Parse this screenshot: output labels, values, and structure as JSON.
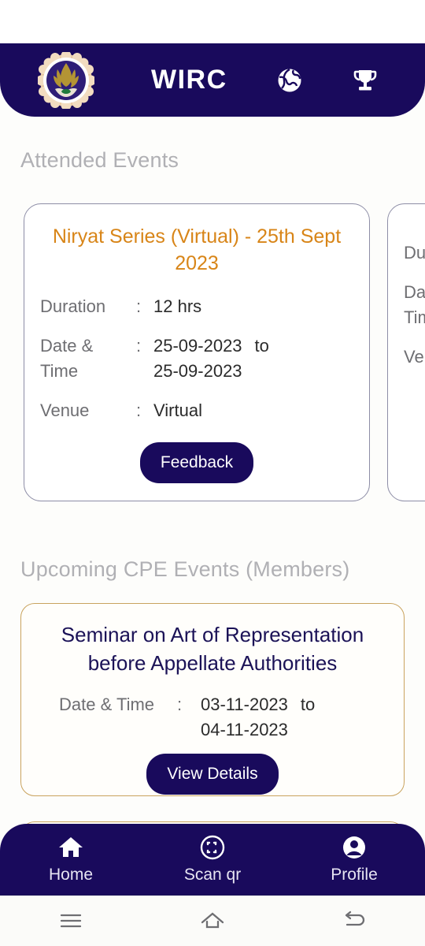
{
  "header": {
    "brand": "WIRC",
    "logo_icon": "icai-emblem-icon",
    "globe_icon": "globe-icon",
    "trophy_icon": "trophy-icon"
  },
  "sections": {
    "attended_title": "Attended Events",
    "upcoming_title": "Upcoming CPE Events (Members)"
  },
  "attended_events": [
    {
      "title": "Niryat Series (Virtual) - 25th Sept 2023",
      "duration_label": "Duration",
      "duration_value": "12 hrs",
      "datetime_label_line1": "Date &",
      "datetime_label_line2": "Time",
      "date_from": "25-09-2023",
      "date_to_word": "to",
      "date_to": "25-09-2023",
      "venue_label": "Venue",
      "venue_value": "Virtual",
      "colon": ":",
      "button_label": "Feedback"
    },
    {
      "title": "",
      "duration_label": "Duration",
      "duration_value": "",
      "datetime_label_line1": "Date &",
      "datetime_label_line2": "Time",
      "date_from": "",
      "date_to_word": "",
      "date_to": "",
      "venue_label": "Venue",
      "venue_value": "",
      "colon": ":",
      "button_label": ""
    }
  ],
  "upcoming_event": {
    "title": "Seminar on Art of Representation before Appellate Authorities",
    "datetime_label": "Date & Time",
    "colon": ":",
    "date_from": "03-11-2023",
    "date_to_word": "to",
    "date_to": "04-11-2023",
    "button_label": "View Details"
  },
  "bottom_nav": [
    {
      "label": "Home",
      "icon": "home-icon"
    },
    {
      "label": "Scan qr",
      "icon": "qr-scan-icon"
    },
    {
      "label": "Profile",
      "icon": "profile-icon"
    }
  ],
  "system_nav": [
    {
      "icon": "recents-icon"
    },
    {
      "icon": "home-outline-icon"
    },
    {
      "icon": "back-icon"
    }
  ],
  "colors": {
    "navy": "#190a5c",
    "orange": "#d88518",
    "gold": "#c9a35e",
    "muted": "#b0b0b4"
  }
}
